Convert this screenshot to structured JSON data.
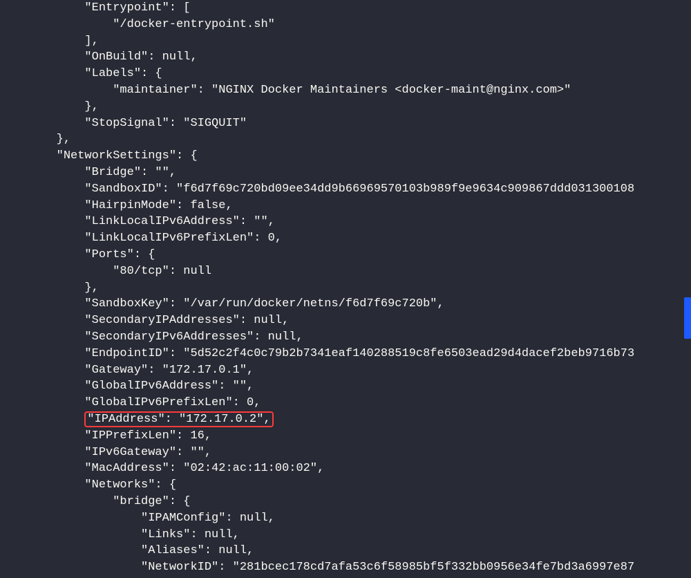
{
  "lines": [
    {
      "indent": 3,
      "text": "\"Entrypoint\": ["
    },
    {
      "indent": 4,
      "text": "\"/docker-entrypoint.sh\""
    },
    {
      "indent": 3,
      "text": "],"
    },
    {
      "indent": 3,
      "text": "\"OnBuild\": null,"
    },
    {
      "indent": 3,
      "text": "\"Labels\": {"
    },
    {
      "indent": 4,
      "text": "\"maintainer\": \"NGINX Docker Maintainers <docker-maint@nginx.com>\""
    },
    {
      "indent": 3,
      "text": "},"
    },
    {
      "indent": 3,
      "text": "\"StopSignal\": \"SIGQUIT\""
    },
    {
      "indent": 2,
      "text": "},"
    },
    {
      "indent": 2,
      "text": "\"NetworkSettings\": {"
    },
    {
      "indent": 3,
      "text": "\"Bridge\": \"\","
    },
    {
      "indent": 3,
      "text": "\"SandboxID\": \"f6d7f69c720bd09ee34dd9b66969570103b989f9e9634c909867ddd031300108"
    },
    {
      "indent": 0,
      "text": ""
    },
    {
      "indent": 3,
      "text": "\"HairpinMode\": false,"
    },
    {
      "indent": 3,
      "text": "\"LinkLocalIPv6Address\": \"\","
    },
    {
      "indent": 3,
      "text": "\"LinkLocalIPv6PrefixLen\": 0,"
    },
    {
      "indent": 3,
      "text": "\"Ports\": {"
    },
    {
      "indent": 4,
      "text": "\"80/tcp\": null"
    },
    {
      "indent": 3,
      "text": "},"
    },
    {
      "indent": 3,
      "text": "\"SandboxKey\": \"/var/run/docker/netns/f6d7f69c720b\","
    },
    {
      "indent": 3,
      "text": "\"SecondaryIPAddresses\": null,"
    },
    {
      "indent": 3,
      "text": "\"SecondaryIPv6Addresses\": null,"
    },
    {
      "indent": 3,
      "text": "\"EndpointID\": \"5d52c2f4c0c79b2b7341eaf140288519c8fe6503ead29d4dacef2beb9716b73"
    },
    {
      "indent": 0,
      "text": ""
    },
    {
      "indent": 3,
      "text": "\"Gateway\": \"172.17.0.1\","
    },
    {
      "indent": 3,
      "text": "\"GlobalIPv6Address\": \"\","
    },
    {
      "indent": 3,
      "text": "\"GlobalIPv6PrefixLen\": 0,"
    },
    {
      "indent": 3,
      "text": "\"IPAddress\": \"172.17.0.2\",",
      "highlight": true
    },
    {
      "indent": 3,
      "text": "\"IPPrefixLen\": 16,"
    },
    {
      "indent": 3,
      "text": "\"IPv6Gateway\": \"\","
    },
    {
      "indent": 3,
      "text": "\"MacAddress\": \"02:42:ac:11:00:02\","
    },
    {
      "indent": 3,
      "text": "\"Networks\": {"
    },
    {
      "indent": 4,
      "text": "\"bridge\": {"
    },
    {
      "indent": 5,
      "text": "\"IPAMConfig\": null,"
    },
    {
      "indent": 5,
      "text": "\"Links\": null,"
    },
    {
      "indent": 5,
      "text": "\"Aliases\": null,"
    },
    {
      "indent": 5,
      "text": "\"NetworkID\": \"281bcec178cd7afa53c6f58985bf5f332bb0956e34fe7bd3a6997e87"
    }
  ],
  "indentUnit": "    "
}
